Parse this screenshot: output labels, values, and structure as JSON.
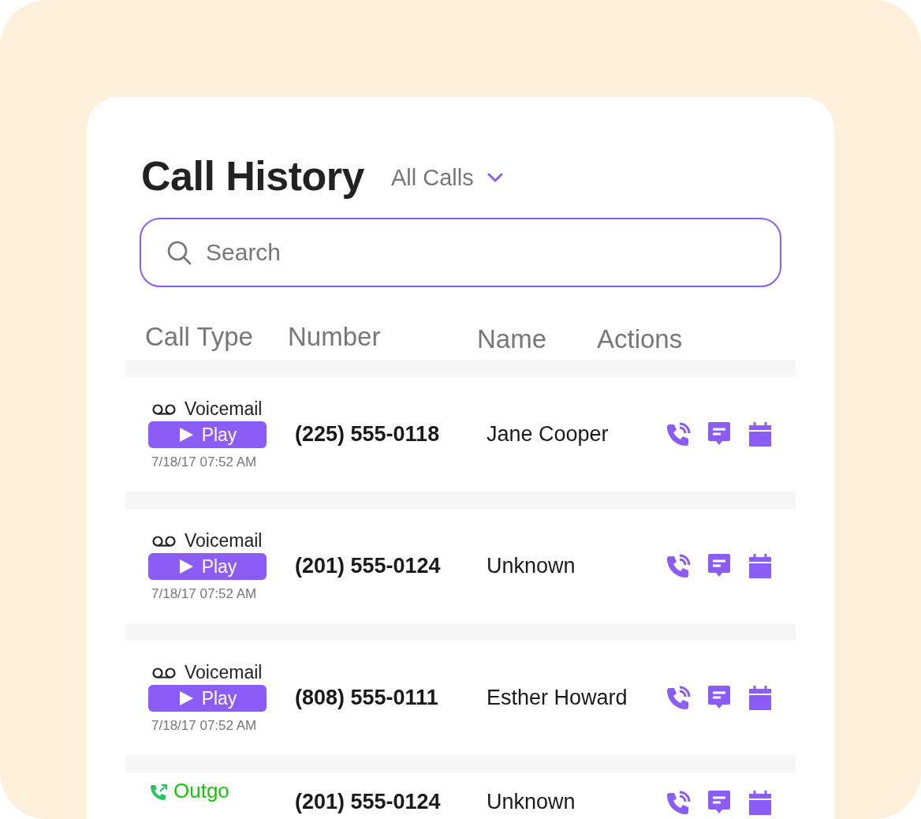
{
  "title": "Call History",
  "filter": {
    "label": "All Calls"
  },
  "search": {
    "placeholder": "Search"
  },
  "columns": [
    "Call Type",
    "Number",
    "Name",
    "Actions"
  ],
  "rows": [
    {
      "kind": "voicemail",
      "call_type": "Voicemail",
      "play": "Play",
      "time": "7/18/17 07:52 AM",
      "number": "(225) 555-0118",
      "name": "Jane Cooper"
    },
    {
      "kind": "voicemail",
      "call_type": "Voicemail",
      "play": "Play",
      "time": "7/18/17 07:52 AM",
      "number": "(201) 555-0124",
      "name": "Unknown"
    },
    {
      "kind": "voicemail",
      "call_type": "Voicemail",
      "play": "Play",
      "time": "7/18/17 07:52 AM",
      "number": "(808) 555-0111",
      "name": "Esther Howard"
    },
    {
      "kind": "outgoing",
      "call_type": "Outgo",
      "number": "(201) 555-0124",
      "name": "Unknown"
    }
  ]
}
